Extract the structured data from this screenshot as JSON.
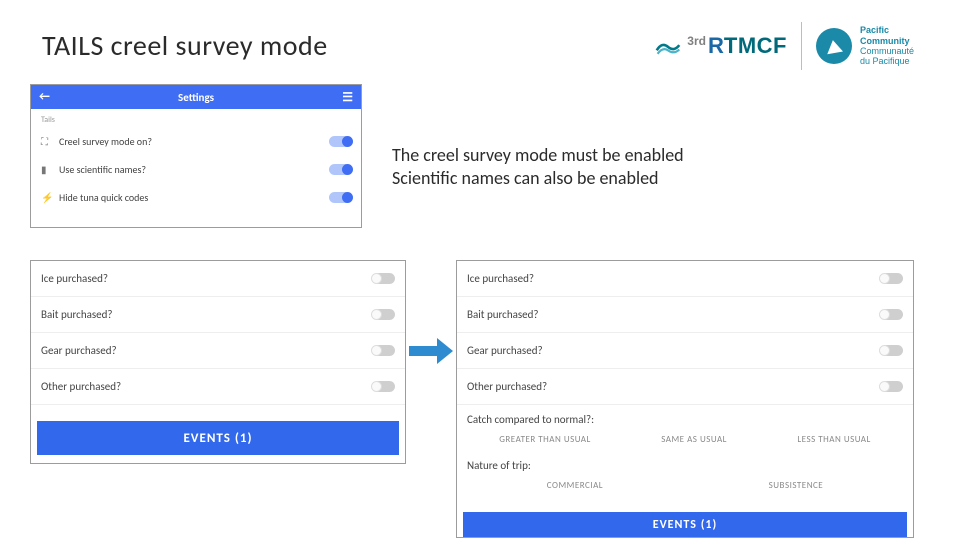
{
  "title": "TAILS creel survey mode",
  "logos": {
    "rtmcf": {
      "prefix": "3rd",
      "r": "R",
      "tmcf": "TMCF"
    },
    "spc": {
      "line1": "Pacific",
      "line2": "Community",
      "line3": "Communauté",
      "line4": "du Pacifique"
    }
  },
  "explain": {
    "line1": "The creel survey mode must be enabled",
    "line2": "Scientific names can also be enabled"
  },
  "settings": {
    "header": "Settings",
    "section_label": "Tails",
    "rows": [
      {
        "icon": "⛶",
        "label": "Creel survey mode on?",
        "on": true
      },
      {
        "icon": "▮",
        "label": "Use scientific names?",
        "on": true
      },
      {
        "icon": "⚡",
        "label": "Hide tuna quick codes",
        "on": true
      }
    ]
  },
  "survey_a": {
    "rows": [
      {
        "label": "Ice purchased?",
        "on": false
      },
      {
        "label": "Bait purchased?",
        "on": false
      },
      {
        "label": "Gear purchased?",
        "on": false
      },
      {
        "label": "Other purchased?",
        "on": false
      }
    ],
    "button": "EVENTS (1)"
  },
  "survey_b": {
    "rows": [
      {
        "label": "Ice purchased?",
        "on": false
      },
      {
        "label": "Bait purchased?",
        "on": false
      },
      {
        "label": "Gear purchased?",
        "on": false
      },
      {
        "label": "Other purchased?",
        "on": false
      }
    ],
    "catch": {
      "label": "Catch compared to normal?:",
      "options": [
        "GREATER THAN USUAL",
        "SAME AS USUAL",
        "LESS THAN USUAL"
      ]
    },
    "nature": {
      "label": "Nature of trip:",
      "options": [
        "COMMERCIAL",
        "SUBSISTENCE"
      ]
    },
    "button": "EVENTS (1)"
  }
}
